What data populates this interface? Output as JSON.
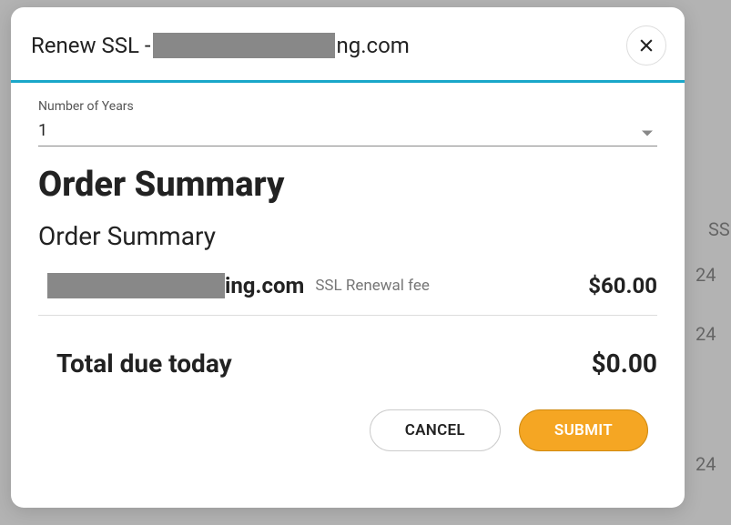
{
  "header": {
    "title_prefix": "Renew SSL - ",
    "title_suffix": "ng.com"
  },
  "form": {
    "years_label": "Number of Years",
    "years_value": "1"
  },
  "summary": {
    "heading_large": "Order Summary",
    "heading_small": "Order Summary",
    "line_item": {
      "domain_suffix": "ing.com",
      "description": "SSL Renewal fee",
      "amount": "$60.00"
    },
    "total_label": "Total due today",
    "total_amount": "$0.00"
  },
  "actions": {
    "cancel": "CANCEL",
    "submit": "SUBMIT"
  },
  "background": {
    "col": "SS",
    "v1": "24",
    "v2": "24",
    "v3": "24"
  }
}
